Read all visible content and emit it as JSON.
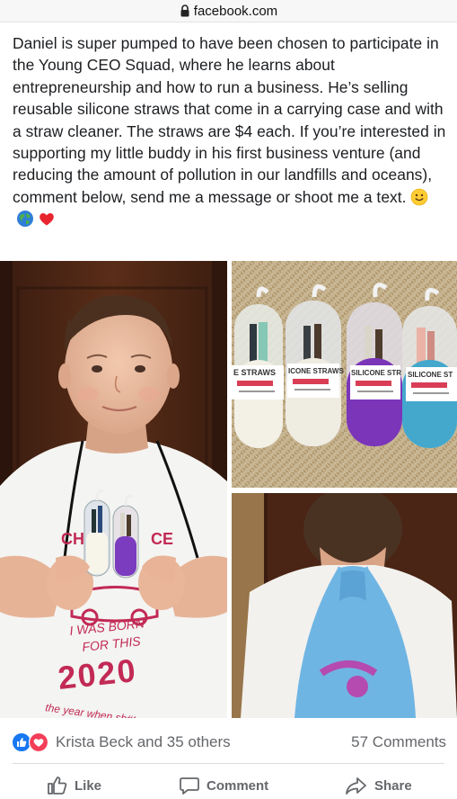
{
  "browser": {
    "url": "facebook.com",
    "lock_icon": "lock-icon"
  },
  "post": {
    "text": "Daniel is super pumped to have been chosen to participate in the Young CEO Squad, where he learns about entrepreneurship and how to run a business. He’s selling reusable silicone straws that come in a carrying case and with a straw cleaner. The straws are $4 each. If you’re interested in supporting my little buddy in his first business venture (and reducing the amount of pollution in our landfills and oceans), comment below, send me a message or shoot me a text.",
    "emojis": [
      "smiley-emoji",
      "globe-emoji",
      "heart-emoji"
    ]
  },
  "photos": {
    "boy": {
      "shirt_line1": "I WAS BORN",
      "shirt_line2": "FOR THIS",
      "shirt_year": "2020",
      "shirt_line3": "the year when sh#t got real"
    },
    "straws": {
      "case_labels": [
        "E STRAWS",
        "ICONE STRAWS",
        "SILICONE STR",
        "SILICONE ST"
      ],
      "case_colors": [
        "#f3f0e6",
        "#efece2",
        "#7a35b8",
        "#43a8cc"
      ]
    },
    "back": {}
  },
  "reactions": {
    "icons": [
      "like-icon",
      "love-icon"
    ],
    "names": "Krista Beck and 35 others",
    "comments": "57 Comments"
  },
  "actions": {
    "like": "Like",
    "comment": "Comment",
    "share": "Share"
  },
  "colors": {
    "facebook_blue": "#1877f2",
    "love_red": "#f33e58",
    "secondary_text": "#65676b"
  }
}
